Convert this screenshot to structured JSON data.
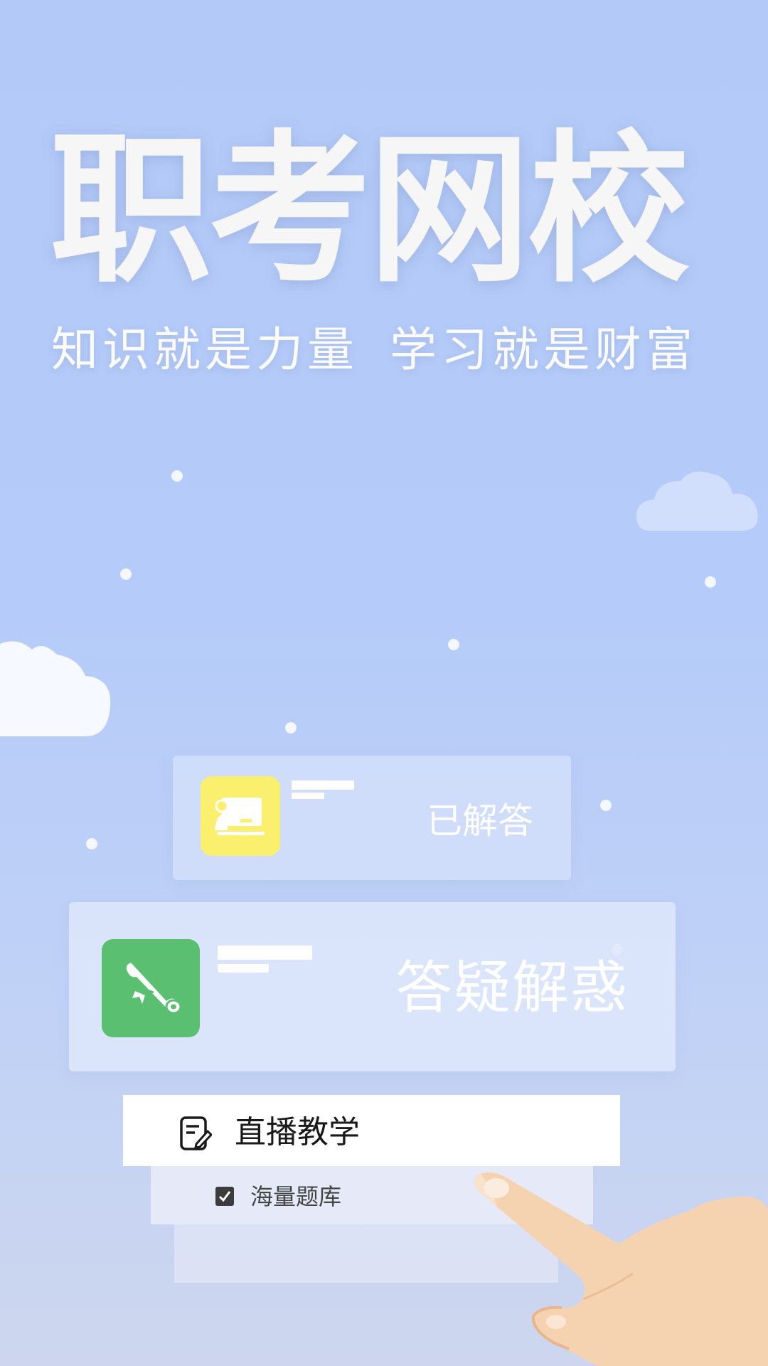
{
  "headline": {
    "title": "职考网校",
    "subtitle_left": "知识就是力量",
    "subtitle_right": "学习就是财富"
  },
  "cards": {
    "top": {
      "status_label": "已解答",
      "icon": "teacher-board-icon",
      "icon_color": "#fbef6e"
    },
    "middle": {
      "label": "答疑解惑",
      "icon": "diploma-scroll-icon",
      "icon_color": "#5bbf72"
    }
  },
  "menu": {
    "primary": {
      "label": "直播教学",
      "icon": "document-edit-icon"
    },
    "secondary": {
      "label": "海量题库",
      "icon": "checkbox-icon"
    }
  },
  "colors": {
    "background": "#b3caf8",
    "text_light": "#f6f6f7"
  }
}
